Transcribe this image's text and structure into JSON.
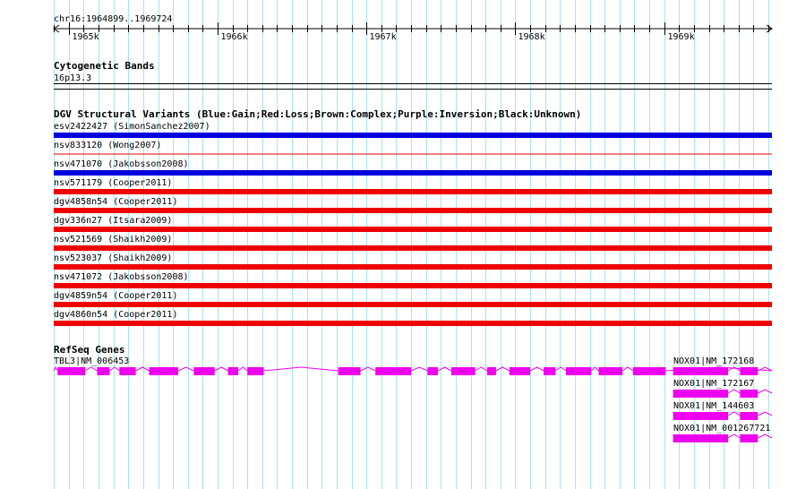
{
  "ruler": {
    "region": "chr16:1964899..1969724",
    "start": 1964899,
    "end": 1969724,
    "ticks": [
      {
        "pos": 1965000,
        "label": "1965k"
      },
      {
        "pos": 1966000,
        "label": "1966k"
      },
      {
        "pos": 1967000,
        "label": "1967k"
      },
      {
        "pos": 1968000,
        "label": "1968k"
      },
      {
        "pos": 1969000,
        "label": "1969k"
      }
    ]
  },
  "cytobands": {
    "title": "Cytogenetic Bands",
    "band": "16p13.3"
  },
  "dgv": {
    "title": "DGV Structural Variants (Blue:Gain;Red:Loss;Brown:Complex;Purple:Inversion;Black:Unknown)",
    "colors": {
      "gain": "#0000dd",
      "loss": "#ee0000"
    },
    "variants": [
      {
        "label": "esv2422427 (SimonSanchez2007)",
        "type": "gain",
        "style": "thick"
      },
      {
        "label": "nsv833120 (Wong2007)",
        "type": "loss",
        "style": "thin"
      },
      {
        "label": "nsv471070 (Jakobsson2008)",
        "type": "gain",
        "style": "thick"
      },
      {
        "label": "nsv571179 (Cooper2011)",
        "type": "loss",
        "style": "thick"
      },
      {
        "label": "dgv4858n54 (Cooper2011)",
        "type": "loss",
        "style": "thick"
      },
      {
        "label": "dgv336n27 (Itsara2009)",
        "type": "loss",
        "style": "thick"
      },
      {
        "label": "nsv521569 (Shaikh2009)",
        "type": "loss",
        "style": "thick"
      },
      {
        "label": "nsv523037 (Shaikh2009)",
        "type": "loss",
        "style": "thick"
      },
      {
        "label": "nsv471072 (Jakobsson2008)",
        "type": "loss",
        "style": "thick"
      },
      {
        "label": "dgv4859n54 (Cooper2011)",
        "type": "loss",
        "style": "thick"
      },
      {
        "label": "dgv4860n54 (Cooper2011)",
        "type": "loss",
        "style": "thick"
      }
    ]
  },
  "refseq": {
    "title": "RefSeq Genes",
    "exon_color": "#ee00ee",
    "genes": [
      {
        "label": "TBL3|NM_006453",
        "start": 1964899,
        "end": 1969724,
        "exons": [
          [
            1964925,
            1965110
          ],
          [
            1965190,
            1965275
          ],
          [
            1965340,
            1965450
          ],
          [
            1965540,
            1965735
          ],
          [
            1965840,
            1965980
          ],
          [
            1966070,
            1966140
          ],
          [
            1966200,
            1966310
          ],
          [
            1966810,
            1966960
          ],
          [
            1967060,
            1967300
          ],
          [
            1967410,
            1967480
          ],
          [
            1967570,
            1967730
          ],
          [
            1967810,
            1967870
          ],
          [
            1967960,
            1968100
          ],
          [
            1968190,
            1968270
          ],
          [
            1968340,
            1968510
          ],
          [
            1968560,
            1968720
          ],
          [
            1968790,
            1969010
          ]
        ]
      },
      {
        "label": "NOX01|NM_172168",
        "start": 1969060,
        "end": 1969724,
        "exons": [
          [
            1969060,
            1969430
          ],
          [
            1969510,
            1969630
          ]
        ]
      },
      {
        "label": "NOX01|NM_172167",
        "start": 1969060,
        "end": 1969724,
        "exons": [
          [
            1969060,
            1969430
          ],
          [
            1969510,
            1969630
          ]
        ]
      },
      {
        "label": "NOX01|NM_144603",
        "start": 1969060,
        "end": 1969724,
        "exons": [
          [
            1969060,
            1969430
          ],
          [
            1969510,
            1969630
          ]
        ]
      },
      {
        "label": "NOX01|NM_001267721",
        "start": 1969060,
        "end": 1969724,
        "exons": [
          [
            1969060,
            1969430
          ],
          [
            1969510,
            1969630
          ]
        ]
      }
    ]
  }
}
